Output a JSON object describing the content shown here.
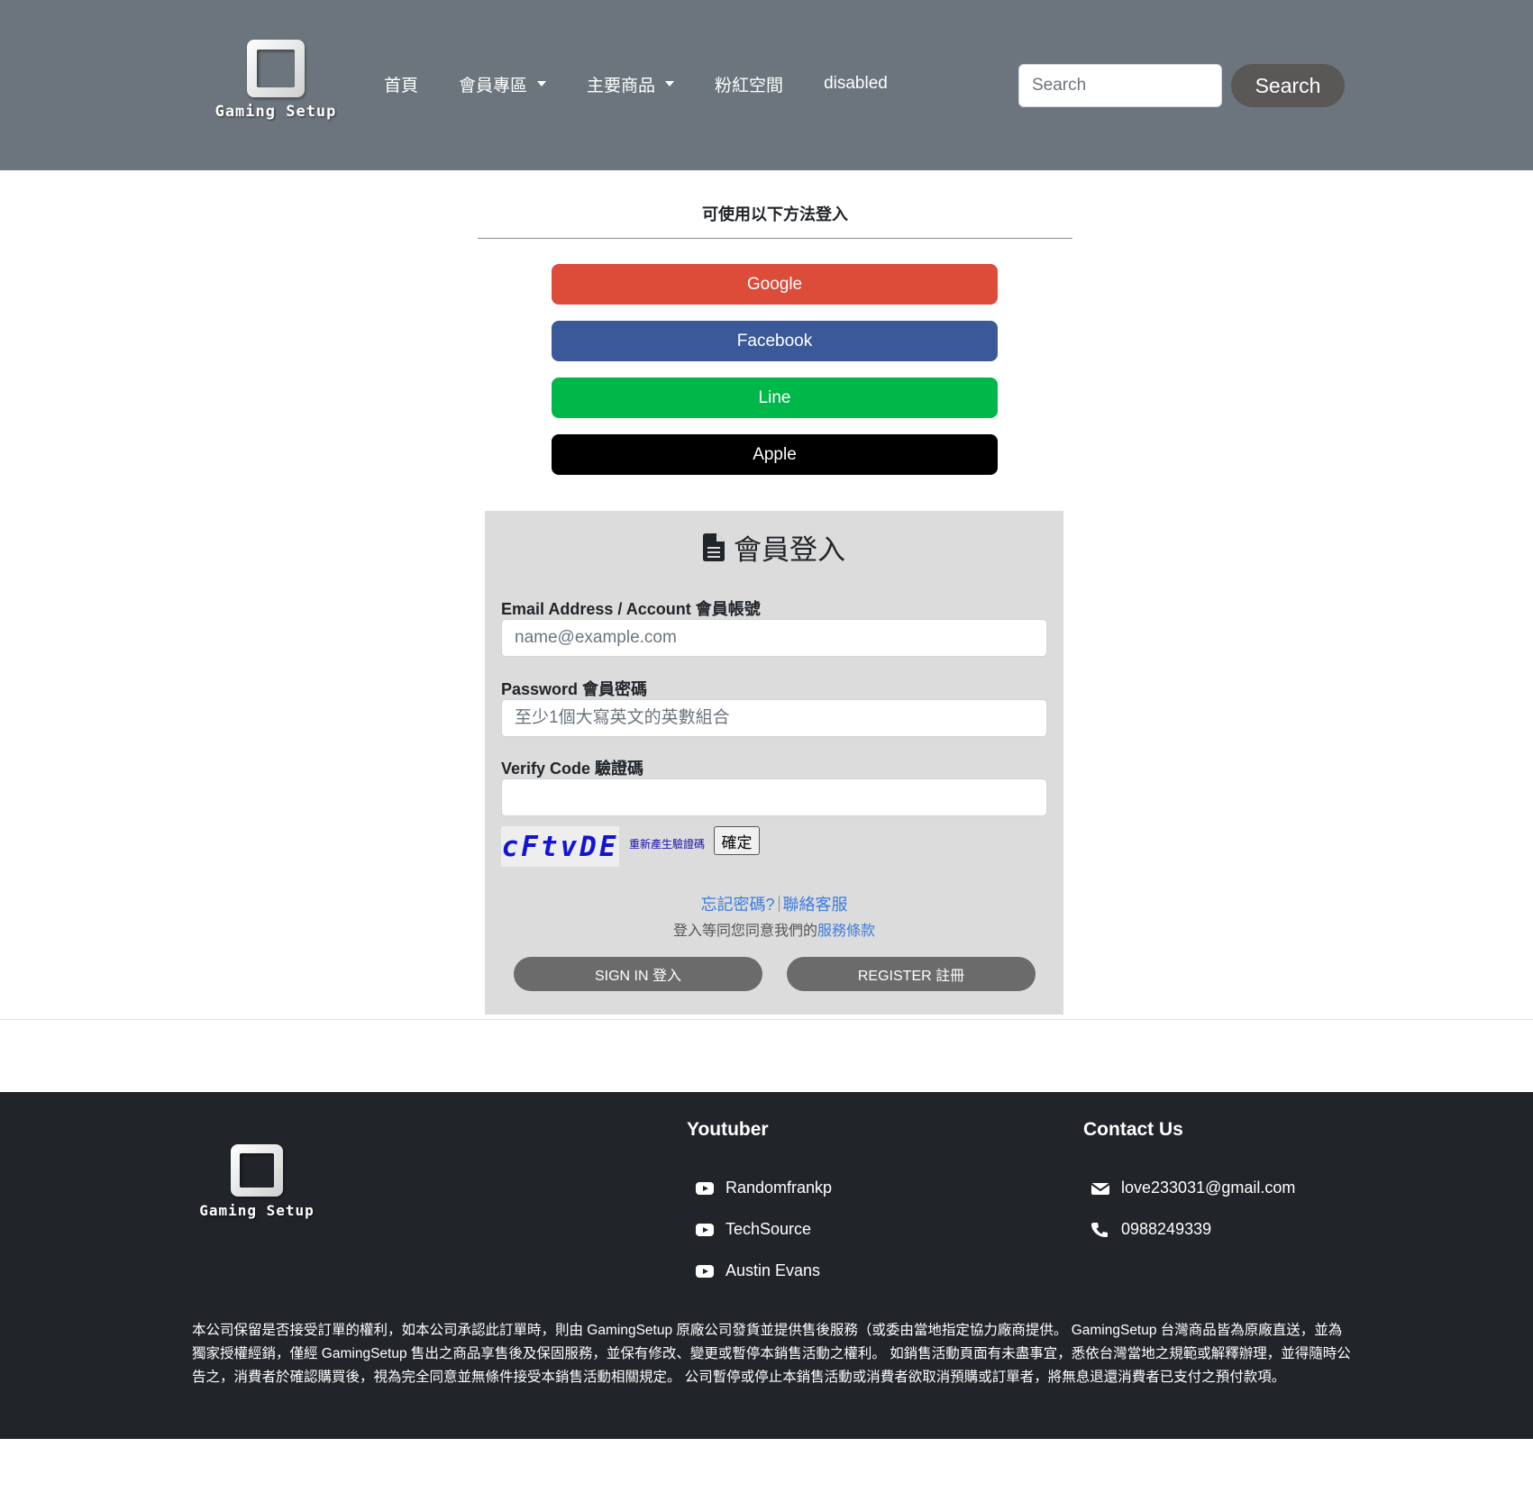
{
  "header": {
    "brand": "Gaming Setup",
    "nav": [
      {
        "label": "首頁"
      },
      {
        "label": "會員專區"
      },
      {
        "label": "主要商品"
      },
      {
        "label": "粉紅空間"
      },
      {
        "label": "disabled"
      }
    ],
    "search": {
      "placeholder": "Search",
      "button_label": "Search"
    }
  },
  "login": {
    "caption": "可使用以下方法登入",
    "social": [
      "Google",
      "Facebook",
      "Line",
      "Apple"
    ],
    "social_colors": {
      "google": "#dd4b39",
      "facebook": "#3b5998",
      "line": "#00b74a",
      "apple": "#000000"
    },
    "card": {
      "title": "會員登入",
      "email": {
        "label": "Email Address / Account 會員帳號",
        "placeholder": "name@example.com"
      },
      "password": {
        "label": "Password 會員密碼",
        "placeholder": "至少1個大寫英文的英數組合"
      },
      "verify": {
        "label": "Verify Code 驗證碼",
        "value": ""
      },
      "captcha": {
        "code": "cFtvDE",
        "refresh_label": "重新產生驗證碼",
        "confirm_label": "確定"
      },
      "forgot_label": "忘記密碼?",
      "support_label": "聯絡客服",
      "terms_prefix": "登入等同您同意我們的",
      "terms_link": "服務條款",
      "signin_label": "SIGN IN 登入",
      "register_label": "REGISTER 註冊"
    }
  },
  "footer": {
    "brand": "Gaming Setup",
    "youtuber": {
      "title": "Youtuber",
      "items": [
        "Randomfrankp",
        "TechSource",
        "Austin Evans"
      ]
    },
    "contact": {
      "title": "Contact Us",
      "email": "love233031@gmail.com",
      "phone": "0988249339"
    },
    "disclaimer": "本公司保留是否接受訂單的權利，如本公司承認此訂單時，則由 GamingSetup 原廠公司發貨並提供售後服務（或委由當地指定協力廠商提供。 GamingSetup 台灣商品皆為原廠直送，並為獨家授權經銷，僅經 GamingSetup 售出之商品享售後及保固服務，並保有修改、變更或暫停本銷售活動之權利。 如銷售活動頁面有未盡事宜，悉依台灣當地之規範或解釋辦理，並得隨時公告之，消費者於確認購買後，視為完全同意並無條件接受本銷售活動相關規定。 公司暫停或停止本銷售活動或消費者欲取消預購或訂單者，將無息退還消費者已支付之預付款項。"
  },
  "colors": {
    "navbar": "#6c757d",
    "footer": "#212529",
    "link": "#3b7ddd",
    "card": "#dcdcdc"
  }
}
